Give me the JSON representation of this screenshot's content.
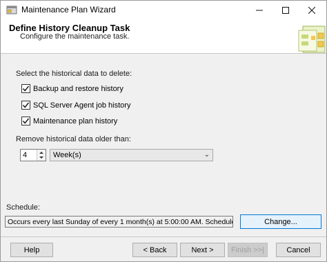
{
  "window": {
    "title": "Maintenance Plan Wizard",
    "icons": [
      "app-icon",
      "minimize-icon",
      "maximize-icon",
      "close-icon",
      "wizard-art-icon"
    ]
  },
  "header": {
    "title": "Define History Cleanup Task",
    "subtitle": "Configure the maintenance task."
  },
  "history": {
    "select_label": "Select the historical data to delete:",
    "options": [
      {
        "label": "Backup and restore history",
        "checked": true
      },
      {
        "label": "SQL Server Agent job history",
        "checked": true
      },
      {
        "label": "Maintenance plan history",
        "checked": true
      }
    ],
    "older_label": "Remove historical data older than:",
    "amount": "4",
    "unit": "Week(s)"
  },
  "schedule": {
    "label": "Schedule:",
    "value": "Occurs every last Sunday of every 1 month(s) at 5:00:00 AM. Schedule will be us",
    "change_label": "Change..."
  },
  "footer": {
    "help": "Help",
    "back": "< Back",
    "next": "Next >",
    "finish": "Finish >>|",
    "cancel": "Cancel"
  }
}
